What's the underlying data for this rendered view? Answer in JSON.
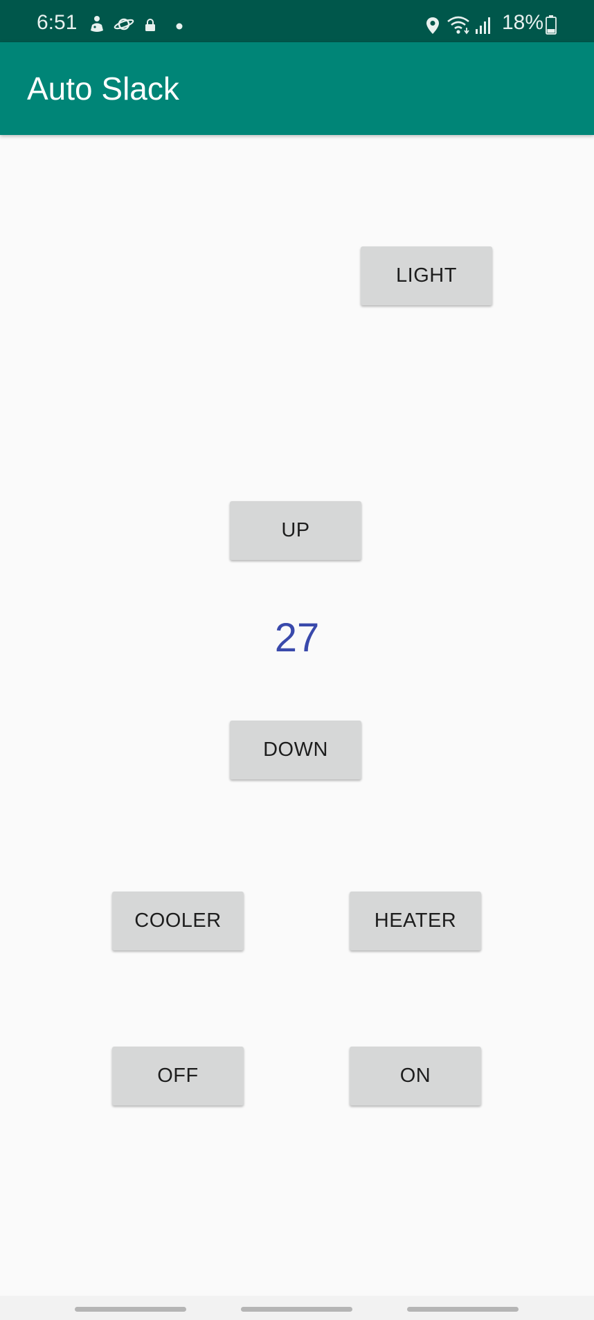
{
  "status_bar": {
    "time": "6:51",
    "battery": "18%",
    "icons": [
      "assistant-icon",
      "saturn-icon",
      "lock-icon",
      "notification-dot-icon",
      "location-icon",
      "wifi-icon",
      "signal-icon",
      "battery-icon"
    ]
  },
  "app_bar": {
    "title": "Auto Slack"
  },
  "controls": {
    "light_label": "LIGHT",
    "up_label": "UP",
    "temperature": "27",
    "down_label": "DOWN",
    "cooler_label": "COOLER",
    "heater_label": "HEATER",
    "off_label": "OFF",
    "on_label": "ON"
  },
  "colors": {
    "status_bar": "#00574b",
    "app_bar": "#008577",
    "background": "#fafafa",
    "button": "#d6d7d7",
    "temperature_text": "#3949ab"
  },
  "nav_bar": {
    "items": [
      "recents-handle",
      "home-handle",
      "back-handle"
    ]
  }
}
